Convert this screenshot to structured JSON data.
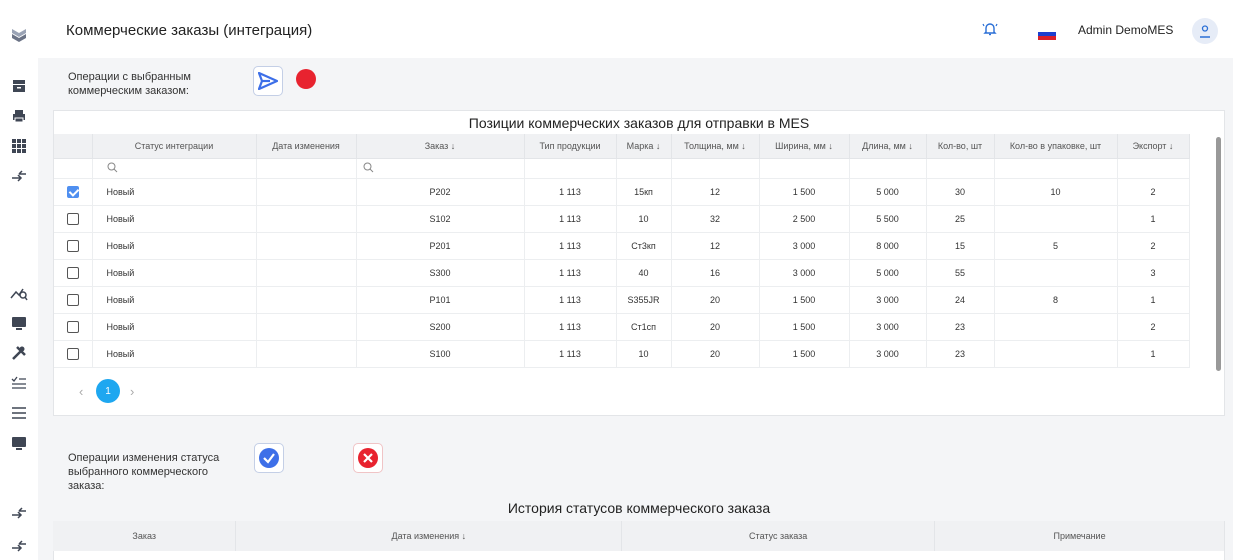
{
  "header": {
    "title": "Коммерческие заказы (интеграция)",
    "user": "Admin DemoMES",
    "icons": [
      "bell-icon",
      "russian-flag-icon",
      "user-avatar-icon"
    ]
  },
  "sidebar": {
    "icons": [
      "app-logo-icon",
      "archive-icon",
      "printer-icon",
      "grid-icon",
      "exchange-arrows-icon",
      "analytics-icon",
      "monitor-icon",
      "tools-icon",
      "checklist-icon",
      "list-icon",
      "monitor-icon",
      "exchange-arrows-icon",
      "exchange-arrows-icon"
    ]
  },
  "ops": {
    "label": "Операции с выбранным коммерческим заказом:",
    "accent": "#3d6fe8",
    "record_color": "#e8232f"
  },
  "positions": {
    "title": "Позиции коммерческих заказов для отправки в MES",
    "columns": [
      "",
      "Статус интеграции",
      "Дата изменения",
      "Заказ ↓",
      "Тип продукции",
      "Марка ↓",
      "Толщина, мм ↓",
      "Ширина, мм ↓",
      "Длина, мм ↓",
      "Кол-во, шт",
      "Кол-во в упаковке, шт",
      "Экспорт ↓"
    ],
    "rows": [
      {
        "checked": true,
        "status": "Новый",
        "date": "",
        "order": "P202",
        "type": "1 113",
        "grade": "15кп",
        "thickness": "12",
        "width": "1 500",
        "length": "5 000",
        "qty": "30",
        "pack": "10",
        "export": "2"
      },
      {
        "checked": false,
        "status": "Новый",
        "date": "",
        "order": "S102",
        "type": "1 113",
        "grade": "10",
        "thickness": "32",
        "width": "2 500",
        "length": "5 500",
        "qty": "25",
        "pack": "",
        "export": "1"
      },
      {
        "checked": false,
        "status": "Новый",
        "date": "",
        "order": "P201",
        "type": "1 113",
        "grade": "Ст3кп",
        "thickness": "12",
        "width": "3 000",
        "length": "8 000",
        "qty": "15",
        "pack": "5",
        "export": "2"
      },
      {
        "checked": false,
        "status": "Новый",
        "date": "",
        "order": "S300",
        "type": "1 113",
        "grade": "40",
        "thickness": "16",
        "width": "3 000",
        "length": "5 000",
        "qty": "55",
        "pack": "",
        "export": "3"
      },
      {
        "checked": false,
        "status": "Новый",
        "date": "",
        "order": "P101",
        "type": "1 113",
        "grade": "S355JR",
        "thickness": "20",
        "width": "1 500",
        "length": "3 000",
        "qty": "24",
        "pack": "8",
        "export": "1"
      },
      {
        "checked": false,
        "status": "Новый",
        "date": "",
        "order": "S200",
        "type": "1 113",
        "grade": "Ст1сп",
        "thickness": "20",
        "width": "1 500",
        "length": "3 000",
        "qty": "23",
        "pack": "",
        "export": "2"
      },
      {
        "checked": false,
        "status": "Новый",
        "date": "",
        "order": "S100",
        "type": "1 113",
        "grade": "10",
        "thickness": "20",
        "width": "1 500",
        "length": "3 000",
        "qty": "23",
        "pack": "",
        "export": "1"
      }
    ],
    "pagination": {
      "current": "1",
      "prev": "‹",
      "next": "›"
    }
  },
  "status_ops": {
    "label": "Операции изменения статуса выбранного коммерческого заказа:",
    "approve_color": "#3d6fe8",
    "reject_color": "#e8232f"
  },
  "history": {
    "title": "История статусов коммерческого заказа",
    "columns": [
      "Заказ",
      "Дата изменения ↓",
      "Статус заказа",
      "Примечание"
    ]
  }
}
